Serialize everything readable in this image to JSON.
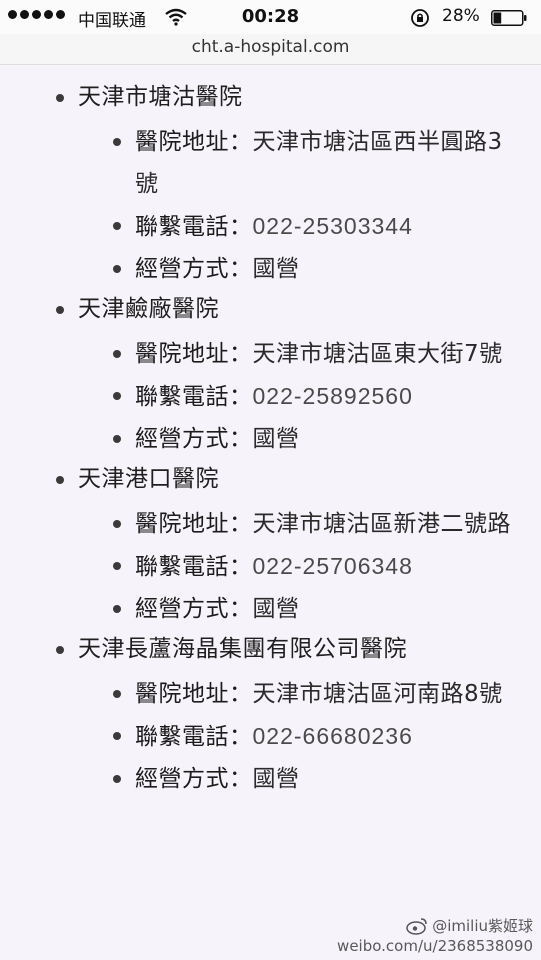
{
  "status_bar": {
    "carrier": "中国联通",
    "time": "00:28",
    "battery_percent": "28%",
    "battery_level": 0.28,
    "signal_bars": 5
  },
  "browser": {
    "url": "cht.a-hospital.com"
  },
  "hospitals": [
    {
      "name": "天津市塘沽醫院",
      "address_label": "醫院地址：",
      "address": "天津市塘沽區西半圓路3號",
      "phone_label": "聯繫電話：",
      "phone": "022-25303344",
      "type_label": "經營方式：",
      "type": "國營"
    },
    {
      "name": "天津鹼廠醫院",
      "address_label": "醫院地址：",
      "address": "天津市塘沽區東大街7號",
      "phone_label": "聯繫電話：",
      "phone": "022-25892560",
      "type_label": "經營方式：",
      "type": "國營"
    },
    {
      "name": "天津港口醫院",
      "address_label": "醫院地址：",
      "address": "天津市塘沽區新港二號路",
      "phone_label": "聯繫電話：",
      "phone": "022-25706348",
      "type_label": "經營方式：",
      "type": "國營"
    },
    {
      "name": "天津長蘆海晶集團有限公司醫院",
      "address_label": "醫院地址：",
      "address": "天津市塘沽區河南路8號",
      "phone_label": "聯繫電話：",
      "phone": "022-66680236",
      "type_label": "經營方式：",
      "type": "國營"
    }
  ],
  "watermark": {
    "handle": "@imiliu紫姬球",
    "url": "weibo.com/u/2368538090"
  }
}
